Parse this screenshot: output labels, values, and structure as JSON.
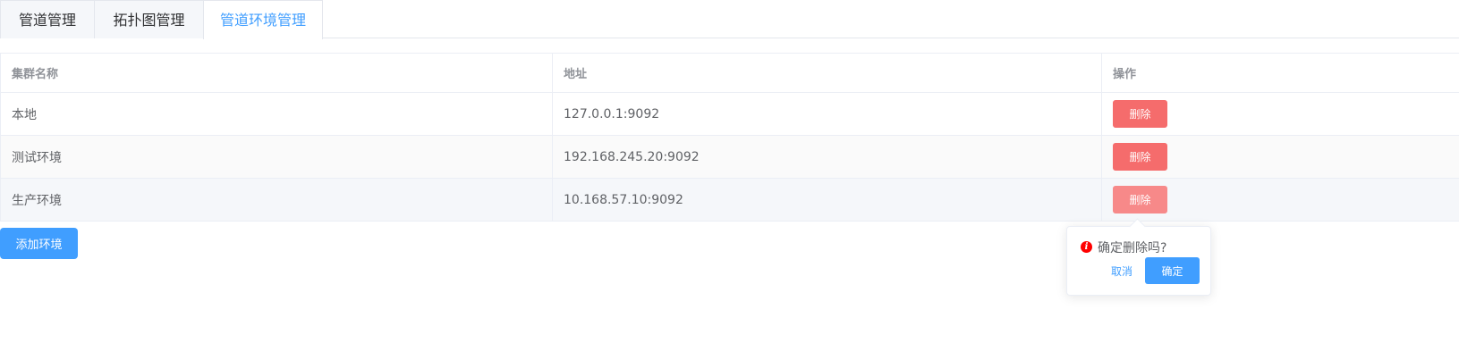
{
  "tabs": [
    {
      "label": "管道管理"
    },
    {
      "label": "拓扑图管理"
    },
    {
      "label": "管道环境管理"
    }
  ],
  "active_tab": "管道环境管理",
  "table": {
    "headers": [
      "集群名称",
      "地址",
      "操作"
    ],
    "rows": [
      {
        "name": "本地",
        "address": "127.0.0.1:9092",
        "action": "删除"
      },
      {
        "name": "测试环境",
        "address": "192.168.245.20:9092",
        "action": "删除"
      },
      {
        "name": "生产环境",
        "address": "10.168.57.10:9092",
        "action": "删除"
      }
    ]
  },
  "add_button": "添加环境",
  "popover": {
    "message": "确定删除吗?",
    "cancel": "取消",
    "confirm": "确定",
    "icon": "warning-info-icon"
  },
  "colors": {
    "primary": "#409eff",
    "danger": "#f56c6c",
    "danger_hover": "#f78989",
    "warning_icon": "#ff0000"
  }
}
